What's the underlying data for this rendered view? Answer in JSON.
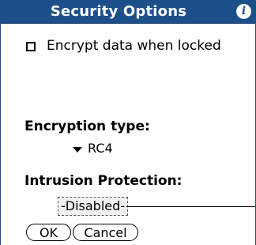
{
  "dialog": {
    "title": "Security Options",
    "info_icon": "i"
  },
  "encrypt": {
    "label": "Encrypt data when locked",
    "checked": false
  },
  "encryption_type": {
    "heading": "Encryption type:",
    "selected": "RC4"
  },
  "intrusion": {
    "heading": "Intrusion Protection:",
    "value": "-Disabled-"
  },
  "buttons": {
    "ok": "OK",
    "cancel": "Cancel"
  },
  "colors": {
    "titlebar": "#1c4f8a"
  }
}
